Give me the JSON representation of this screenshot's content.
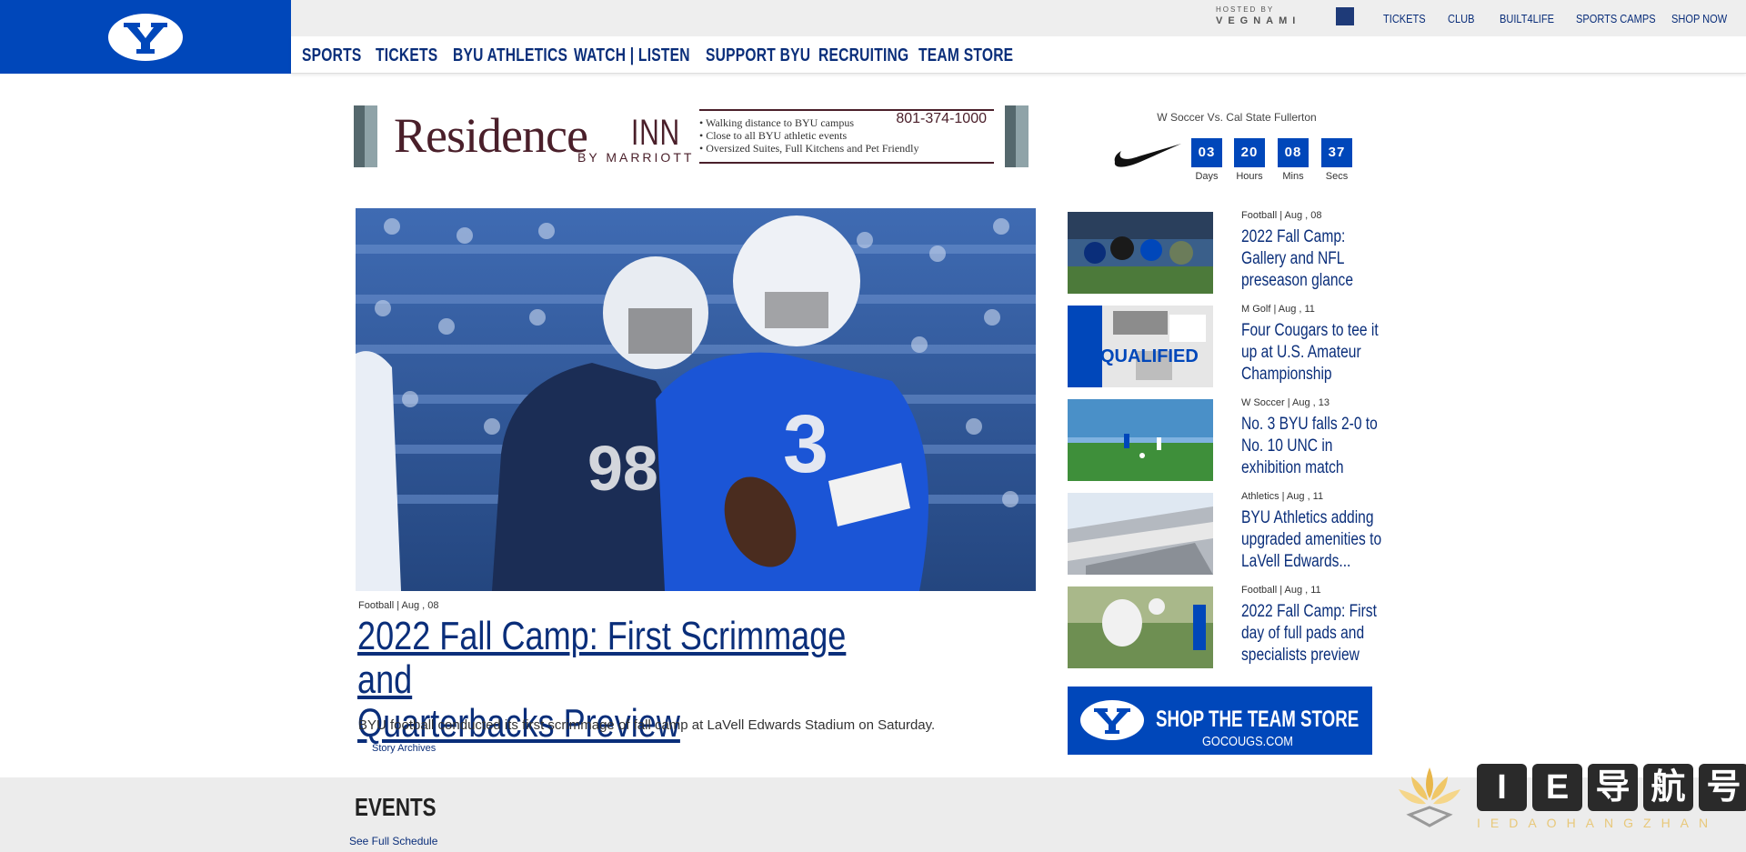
{
  "header": {
    "logo_alt": "BYU Cougars",
    "hosted_by": "HOSTED BY",
    "host_name": "VEGNAMI",
    "utility_links": [
      "TICKETS",
      "CLUB",
      "BUILT4LIFE",
      "SPORTS CAMPS",
      "SHOP NOW"
    ],
    "nav_items": [
      "SPORTS",
      "TICKETS",
      "BYU ATHLETICS",
      "WATCH | LISTEN",
      "SUPPORT BYU",
      "RECRUITING",
      "TEAM STORE"
    ]
  },
  "ad": {
    "brand": "Residence",
    "brand_suffix": "INN",
    "sub": "BY MARRIOTT",
    "phone": "801-374-1000",
    "bullets": [
      "Walking distance to BYU campus",
      "Close to all BYU athletic events",
      "Oversized Suites, Full Kitchens and Pet Friendly"
    ]
  },
  "countdown": {
    "event": "W Soccer Vs. Cal State Fullerton",
    "units": [
      {
        "value": "03",
        "label": "Days"
      },
      {
        "value": "20",
        "label": "Hours"
      },
      {
        "value": "08",
        "label": "Mins"
      },
      {
        "value": "37",
        "label": "Secs"
      }
    ]
  },
  "hero": {
    "meta": "Football | Aug , 08",
    "title_line1": "2022 Fall Camp: First Scrimmage and",
    "title_line2": "Quarterbacks Preview",
    "description": "BYU football conducted its first scrimmage of fall camp at LaVell Edwards Stadium on Saturday.",
    "archives_link": "Story Archives"
  },
  "stories": [
    {
      "meta": "Football | Aug , 08",
      "title": "2022 Fall Camp: Gallery and NFL preseason glance"
    },
    {
      "meta": "M Golf | Aug , 11",
      "title": "Four Cougars to tee it up at U.S. Amateur Championship"
    },
    {
      "meta": "W Soccer | Aug , 13",
      "title": "No. 3 BYU falls 2-0 to No. 10 UNC in exhibition match"
    },
    {
      "meta": "Athletics | Aug , 11",
      "title": "BYU Athletics adding upgraded amenities to LaVell Edwards..."
    },
    {
      "meta": "Football | Aug , 11",
      "title": "2022 Fall Camp: First day of full pads and specialists preview"
    }
  ],
  "story2_thumb_text": "QUALIFIED",
  "team_store": {
    "headline": "SHOP THE TEAM STORE",
    "url": "GOCOUGS.COM"
  },
  "events": {
    "heading": "EVENTS",
    "schedule_link": "See Full Schedule"
  },
  "watermark": {
    "chars": [
      "I",
      "E",
      "导",
      "航",
      "号"
    ],
    "sub": "IEDAOHANGZHAN"
  },
  "colors": {
    "brand_blue": "#0047ba",
    "link_navy": "#0a2e7a",
    "topbar": "#eeeeee"
  }
}
